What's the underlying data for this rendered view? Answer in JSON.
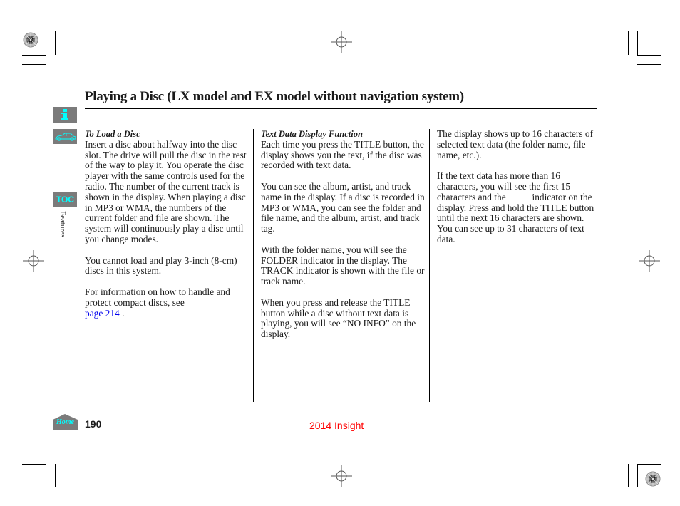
{
  "page": {
    "title": "Playing a Disc (LX model and EX model without navigation system)",
    "section_tab": "Features",
    "page_number": "190",
    "footer_title": "2014 Insight",
    "footer_color": "#ff0000",
    "accent_color": "#00ffff",
    "nav_bg_color": "#7b7b7b"
  },
  "nav": {
    "info_icon": "info-icon",
    "vehicle_icon": "car-icon",
    "toc_label": "TOC",
    "home_label": "Home"
  },
  "columns": [
    {
      "heading": "To Load a Disc",
      "paragraphs": [
        "Insert a disc about halfway into the disc slot. The drive will pull the disc in the rest of the way to play it. You operate the disc player with the same controls used for the radio. The number of the current track is shown in the display. When playing a disc in MP3 or WMA, the numbers of the current folder and file are shown. The system will continuously play a disc until you change modes.",
        "You cannot load and play 3-inch (8-cm) discs in this system.",
        "For information on how to handle and protect compact discs, see"
      ],
      "link_text": "page  214",
      "link_suffix": " ."
    },
    {
      "heading": "Text Data Display Function",
      "paragraphs": [
        "Each time you press the TITLE button, the display shows you the text, if the disc was recorded with text data.",
        "You can see the album, artist, and track name in the display. If a disc is recorded in MP3 or WMA, you can see the folder and file name, and the album, artist, and track tag.",
        "With the folder name, you will see the FOLDER indicator in the display. The TRACK indicator is shown with the file or track name.",
        "When you press and release the TITLE button while a disc without text data is playing, you will see “NO INFO” on the display."
      ]
    },
    {
      "paragraphs": [
        "The display shows up to 16 characters of selected text data (the folder name, file name, etc.).",
        "If the text data has more than 16 characters, you will see the first 15 characters and the           indicator on the display. Press and hold the TITLE button until the next 16 characters are shown. You can see up to 31 characters of text data."
      ]
    }
  ]
}
